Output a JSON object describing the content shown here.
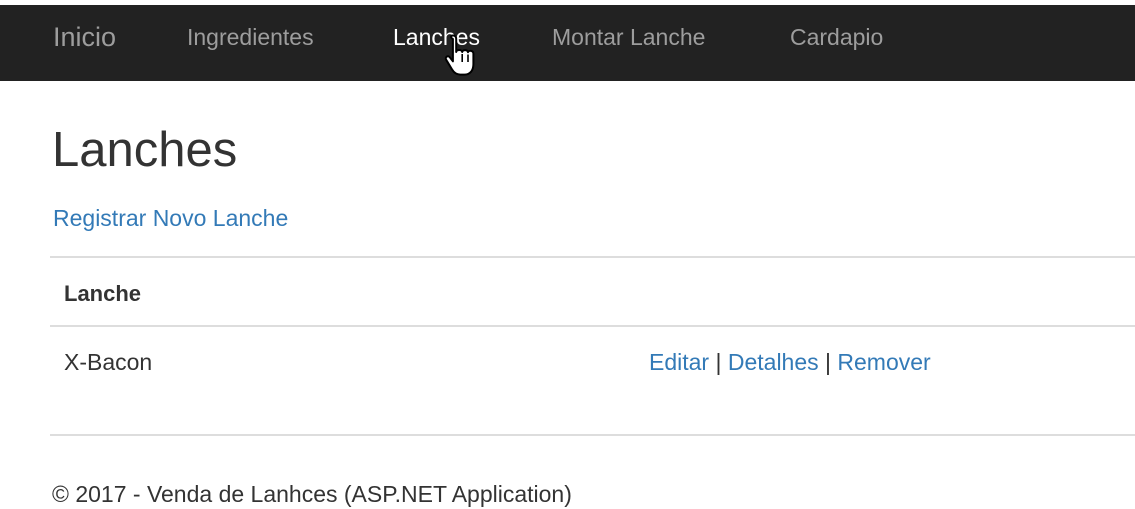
{
  "navbar": {
    "brand": "Inicio",
    "items": [
      {
        "label": "Ingredientes",
        "active": false
      },
      {
        "label": "Lanches",
        "active": true
      },
      {
        "label": "Montar Lanche",
        "active": false
      },
      {
        "label": "Cardapio",
        "active": false
      }
    ]
  },
  "main": {
    "title": "Lanches",
    "create_link": "Registrar Novo Lanche",
    "table": {
      "headers": [
        "Lanche"
      ],
      "rows": [
        {
          "name": "X-Bacon",
          "actions": {
            "edit": "Editar",
            "details": "Detalhes",
            "remove": "Remover",
            "separator": "|"
          }
        }
      ]
    }
  },
  "footer": {
    "text": "© 2017 - Venda de Lanhces (ASP.NET Application)"
  },
  "colors": {
    "navbar_bg": "#222222",
    "nav_text": "#9d9d9d",
    "nav_active": "#ffffff",
    "link": "#337ab7",
    "text": "#333333",
    "divider": "#dddddd"
  },
  "icons": {
    "cursor": "hand-pointer-icon"
  }
}
